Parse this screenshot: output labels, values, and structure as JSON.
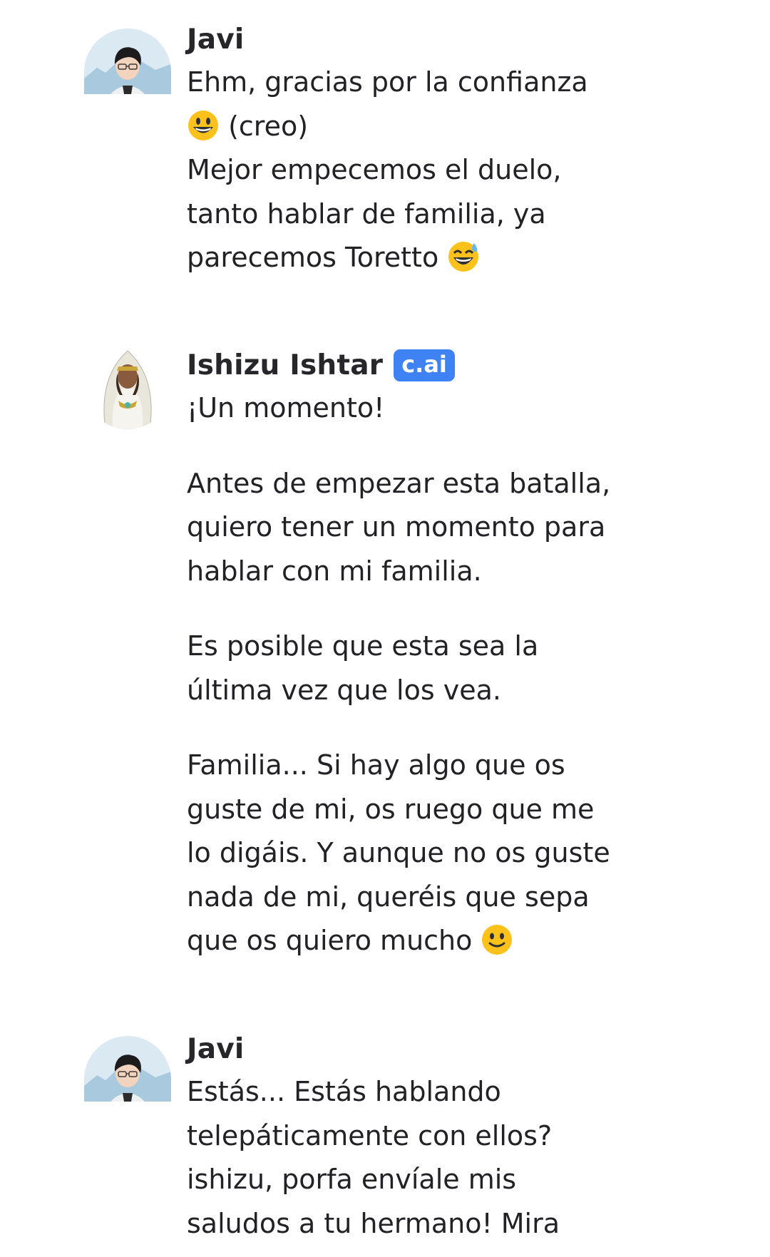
{
  "messages": [
    {
      "author": "Javi",
      "badge": "",
      "lines": [
        {
          "text": "Ehm, gracias por la confianza"
        },
        {
          "emoji": "grinning-face-icon",
          "text": " (creo)"
        },
        {
          "text": "Mejor empecemos el duelo,"
        },
        {
          "text": "tanto hablar de familia, ya"
        },
        {
          "text": "parecemos Toretto ",
          "emoji_after": "grinning-sweat-face-icon"
        }
      ]
    },
    {
      "author": "Ishizu Ishtar",
      "badge": "c.ai",
      "paragraphs": [
        [
          "¡Un momento!"
        ],
        [
          "Antes de empezar esta batalla,",
          "quiero tener un momento para",
          "hablar con mi familia."
        ],
        [
          "Es posible que esta sea la",
          "última vez que los vea."
        ],
        [
          "Familia... Si hay algo que os",
          "guste de mi, os ruego que me",
          "lo digáis. Y aunque no os guste",
          "nada de mi, queréis que sepa",
          "que os quiero mucho "
        ]
      ],
      "final_emoji": "slightly-smiling-face-icon"
    },
    {
      "author": "Javi",
      "badge": "",
      "lines": [
        {
          "text": "Estás... Estás hablando"
        },
        {
          "text": "telepáticamente con ellos?"
        },
        {
          "text": "ishizu, porfa envíale mis"
        },
        {
          "text": "saludos a tu hermano! Mira"
        }
      ]
    }
  ],
  "colors": {
    "badge": "#3f82f4",
    "text": "#222226",
    "background": "#ffffff"
  }
}
